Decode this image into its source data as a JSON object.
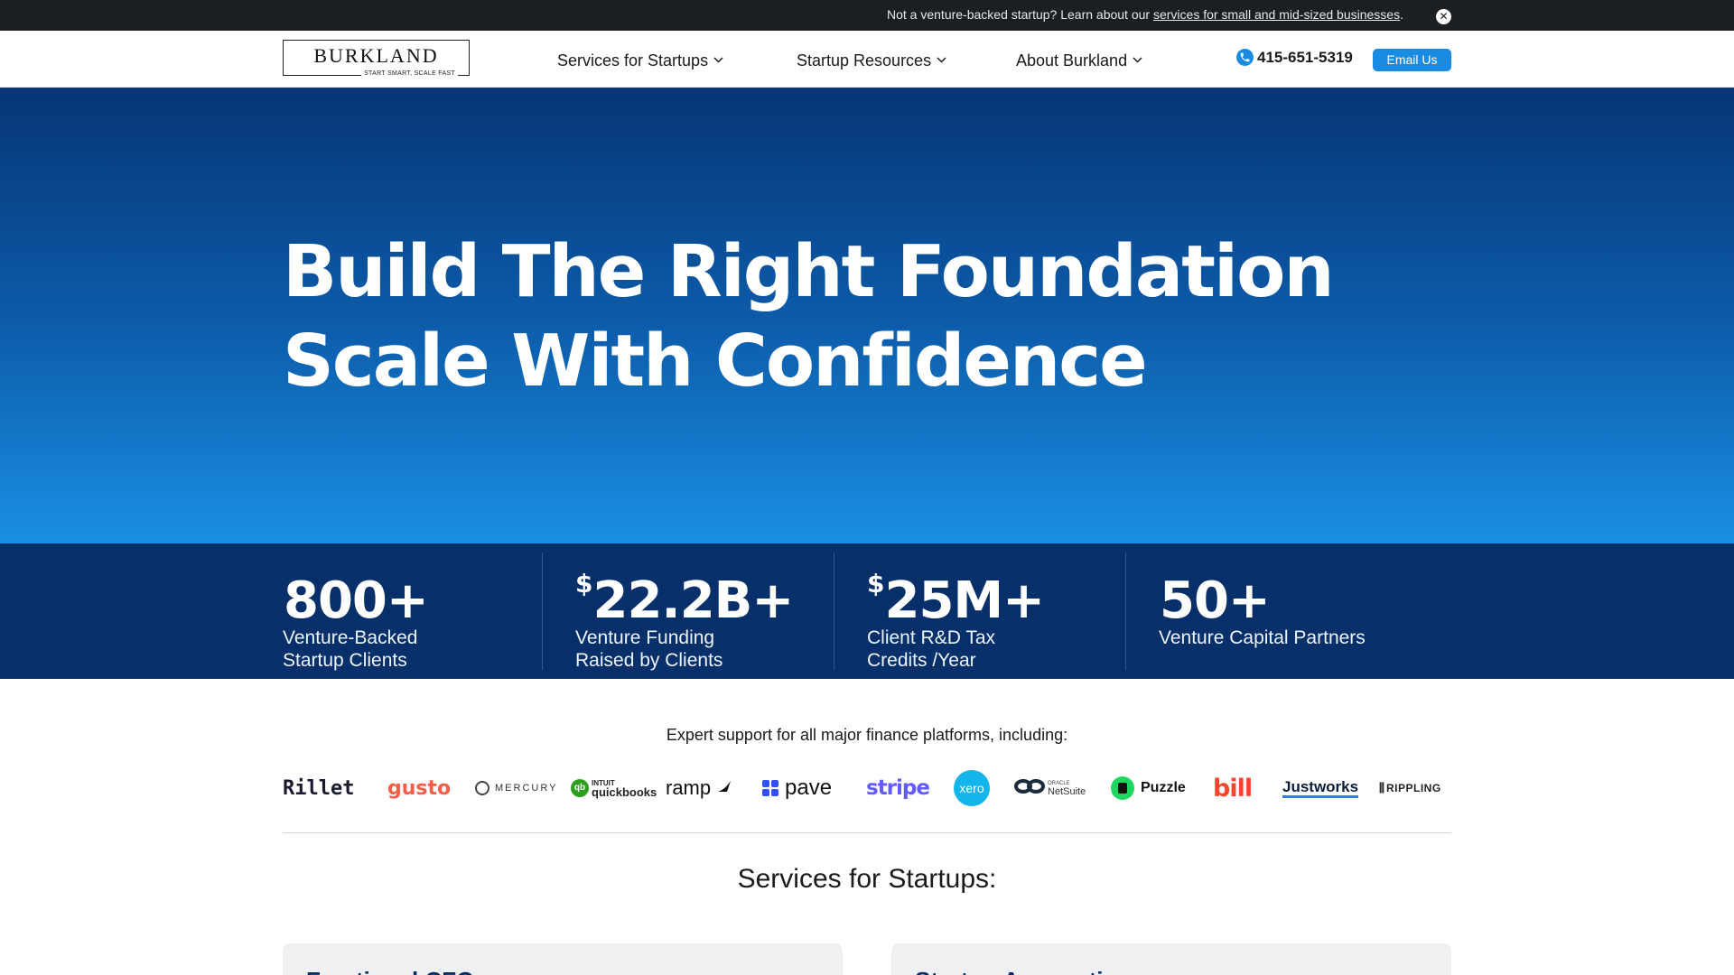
{
  "announcement": {
    "text_before": "Not a venture-backed startup? Learn about our ",
    "link_text": "services for small and mid-sized businesses",
    "text_after": ".",
    "close_icon": "close-icon"
  },
  "header": {
    "logo_word": "BURKLAND",
    "logo_tagline": "START SMART, SCALE FAST",
    "nav": [
      {
        "label": "Services for Startups"
      },
      {
        "label": "Startup Resources"
      },
      {
        "label": "About Burkland"
      }
    ],
    "chevron_icon": "chevron-down-icon",
    "phone": "415-651-5319",
    "phone_icon": "phone-icon",
    "email_button": "Email Us"
  },
  "hero": {
    "line1": "Build The Right Foundation",
    "line2": "Scale With Confidence",
    "gradient_top": "#063675",
    "gradient_bottom": "#1a8fe3"
  },
  "stats": [
    {
      "prefix": "",
      "value": "800+",
      "label_line1": "Venture-Backed",
      "label_line2": "Startup Clients"
    },
    {
      "prefix": "$",
      "value": "22.2B+",
      "label_line1": "Venture Funding",
      "label_line2": "Raised by Clients"
    },
    {
      "prefix": "$",
      "value": "25M+",
      "label_line1": "Client R&D Tax",
      "label_line2": "Credits /Year"
    },
    {
      "prefix": "",
      "value": "50+",
      "label_line1": "Venture Capital Partners",
      "label_line2": ""
    }
  ],
  "platforms": {
    "heading": "Expert support for all major finance platforms, including:",
    "logos": [
      {
        "name": "Rillet"
      },
      {
        "name": "gusto"
      },
      {
        "name": "MERCURY"
      },
      {
        "name": "quickbooks",
        "small": "INTUIT"
      },
      {
        "name": "ramp"
      },
      {
        "name": "pave"
      },
      {
        "name": "stripe"
      },
      {
        "name": "xero"
      },
      {
        "name": "NetSuite",
        "small": "ORACLE"
      },
      {
        "name": "Puzzle"
      },
      {
        "name": "bill"
      },
      {
        "name": "Justworks"
      },
      {
        "name": "RIPPLING"
      }
    ]
  },
  "services": {
    "heading": "Services for Startups:",
    "cards": [
      {
        "title": "Fractional CFO"
      },
      {
        "title": "Startup Accounting"
      }
    ]
  },
  "colors": {
    "accent": "#1a8be3",
    "navy": "#07306a",
    "topbar": "#1c1f22"
  }
}
